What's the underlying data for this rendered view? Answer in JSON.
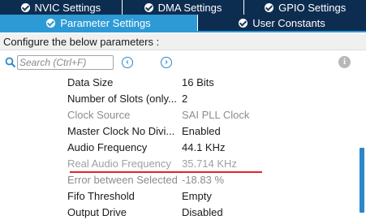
{
  "tabs_top": [
    {
      "label": "NVIC Settings"
    },
    {
      "label": "DMA Settings"
    },
    {
      "label": "GPIO Settings"
    }
  ],
  "tabs_bottom": [
    {
      "label": "Parameter Settings",
      "active": true
    },
    {
      "label": "User Constants",
      "active": false
    }
  ],
  "configure_text": "Configure the below parameters :",
  "search": {
    "placeholder": "Search (Ctrl+F)",
    "value": ""
  },
  "icons": {
    "search": "search-icon",
    "prev": "arrow-left-circle-icon",
    "next": "arrow-right-circle-icon",
    "info": "info-icon",
    "check": "check-circle-icon"
  },
  "parameters": [
    {
      "name": "Data Size",
      "value": "16 Bits",
      "state": "normal"
    },
    {
      "name": "Number of Slots (only...",
      "value": "2",
      "state": "normal"
    },
    {
      "name": "Clock Source",
      "value": "SAI PLL Clock",
      "state": "disabled"
    },
    {
      "name": "Master Clock No Divi...",
      "value": "Enabled",
      "state": "normal"
    },
    {
      "name": "Audio Frequency",
      "value": "44.1 KHz",
      "state": "normal"
    },
    {
      "name": "Real Audio Frequency",
      "value": "35.714 KHz",
      "state": "faded"
    },
    {
      "name": "Error between Selected ...",
      "value": "-18.83 %",
      "state": "disabled"
    },
    {
      "name": "Fifo Threshold",
      "value": "Empty",
      "state": "normal"
    },
    {
      "name": "Output Drive",
      "value": "Disabled",
      "state": "normal"
    }
  ],
  "colors": {
    "tab_dark": "#0d2d50",
    "tab_active": "#2d9ad6",
    "highlight_underline": "#e0232a",
    "scrollbar": "#2d86c8"
  }
}
